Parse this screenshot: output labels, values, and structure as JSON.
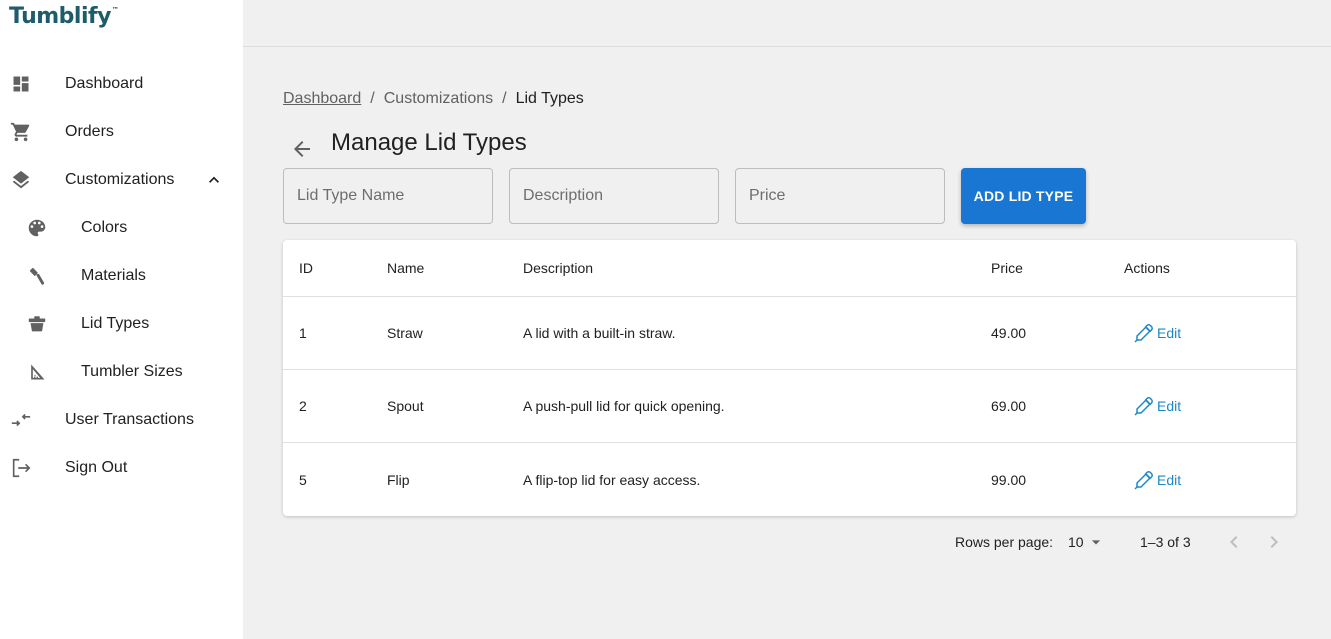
{
  "app": {
    "logo_text": "Tumblify",
    "logo_mark": "™"
  },
  "sidebar": {
    "items": [
      {
        "label": "Dashboard",
        "icon": "dashboard-icon"
      },
      {
        "label": "Orders",
        "icon": "cart-icon"
      },
      {
        "label": "Customizations",
        "icon": "layers-icon",
        "expanded": true
      },
      {
        "label": "Colors",
        "icon": "palette-icon"
      },
      {
        "label": "Materials",
        "icon": "brush-icon"
      },
      {
        "label": "Lid Types",
        "icon": "lid-icon"
      },
      {
        "label": "Tumbler Sizes",
        "icon": "ruler-triangle-icon"
      },
      {
        "label": "User Transactions",
        "icon": "transfer-arrows-icon"
      },
      {
        "label": "Sign Out",
        "icon": "sign-out-icon"
      }
    ]
  },
  "breadcrumb": {
    "items": [
      "Dashboard",
      "Customizations"
    ],
    "separator": "/",
    "current": "Lid Types"
  },
  "page": {
    "title": "Manage Lid Types"
  },
  "form": {
    "name_placeholder": "Lid Type Name",
    "description_placeholder": "Description",
    "price_placeholder": "Price",
    "add_button": "ADD LID TYPE"
  },
  "table": {
    "headers": {
      "id": "ID",
      "name": "Name",
      "description": "Description",
      "price": "Price",
      "actions": "Actions"
    },
    "rows": [
      {
        "id": "1",
        "name": "Straw",
        "description": "A lid with a built-in straw.",
        "price": "49.00",
        "action": "Edit"
      },
      {
        "id": "2",
        "name": "Spout",
        "description": "A push-pull lid for quick opening.",
        "price": "69.00",
        "action": "Edit"
      },
      {
        "id": "5",
        "name": "Flip",
        "description": "A flip-top lid for easy access.",
        "price": "99.00",
        "action": "Edit"
      }
    ]
  },
  "pagination": {
    "rows_per_page_label": "Rows per page:",
    "rows_per_page_value": "10",
    "range": "1–3 of 3"
  },
  "colors": {
    "primary": "#1976d2",
    "logo": "#1c5c6b",
    "edit": "#1e88c7"
  }
}
